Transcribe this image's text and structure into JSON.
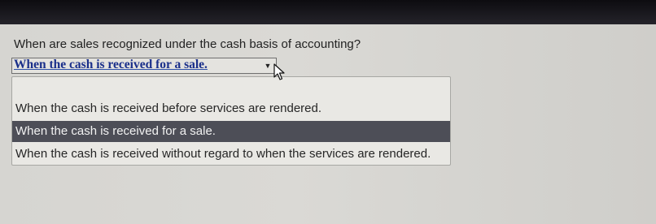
{
  "question": {
    "text": "When are sales recognized under the cash basis of accounting?"
  },
  "select": {
    "value": "When the cash is received for a sale.",
    "arrow_icon": "dropdown-arrow-icon"
  },
  "dropdown": {
    "options": [
      {
        "label": ""
      },
      {
        "label": "When the cash is received before services are rendered."
      },
      {
        "label": "When the cash is received for a sale."
      },
      {
        "label": "When the cash is received without regard to when the services are rendered."
      }
    ],
    "selected_index": 2
  },
  "colors": {
    "selected_bg": "#4d4e57",
    "select_text": "#1a2f8a"
  }
}
